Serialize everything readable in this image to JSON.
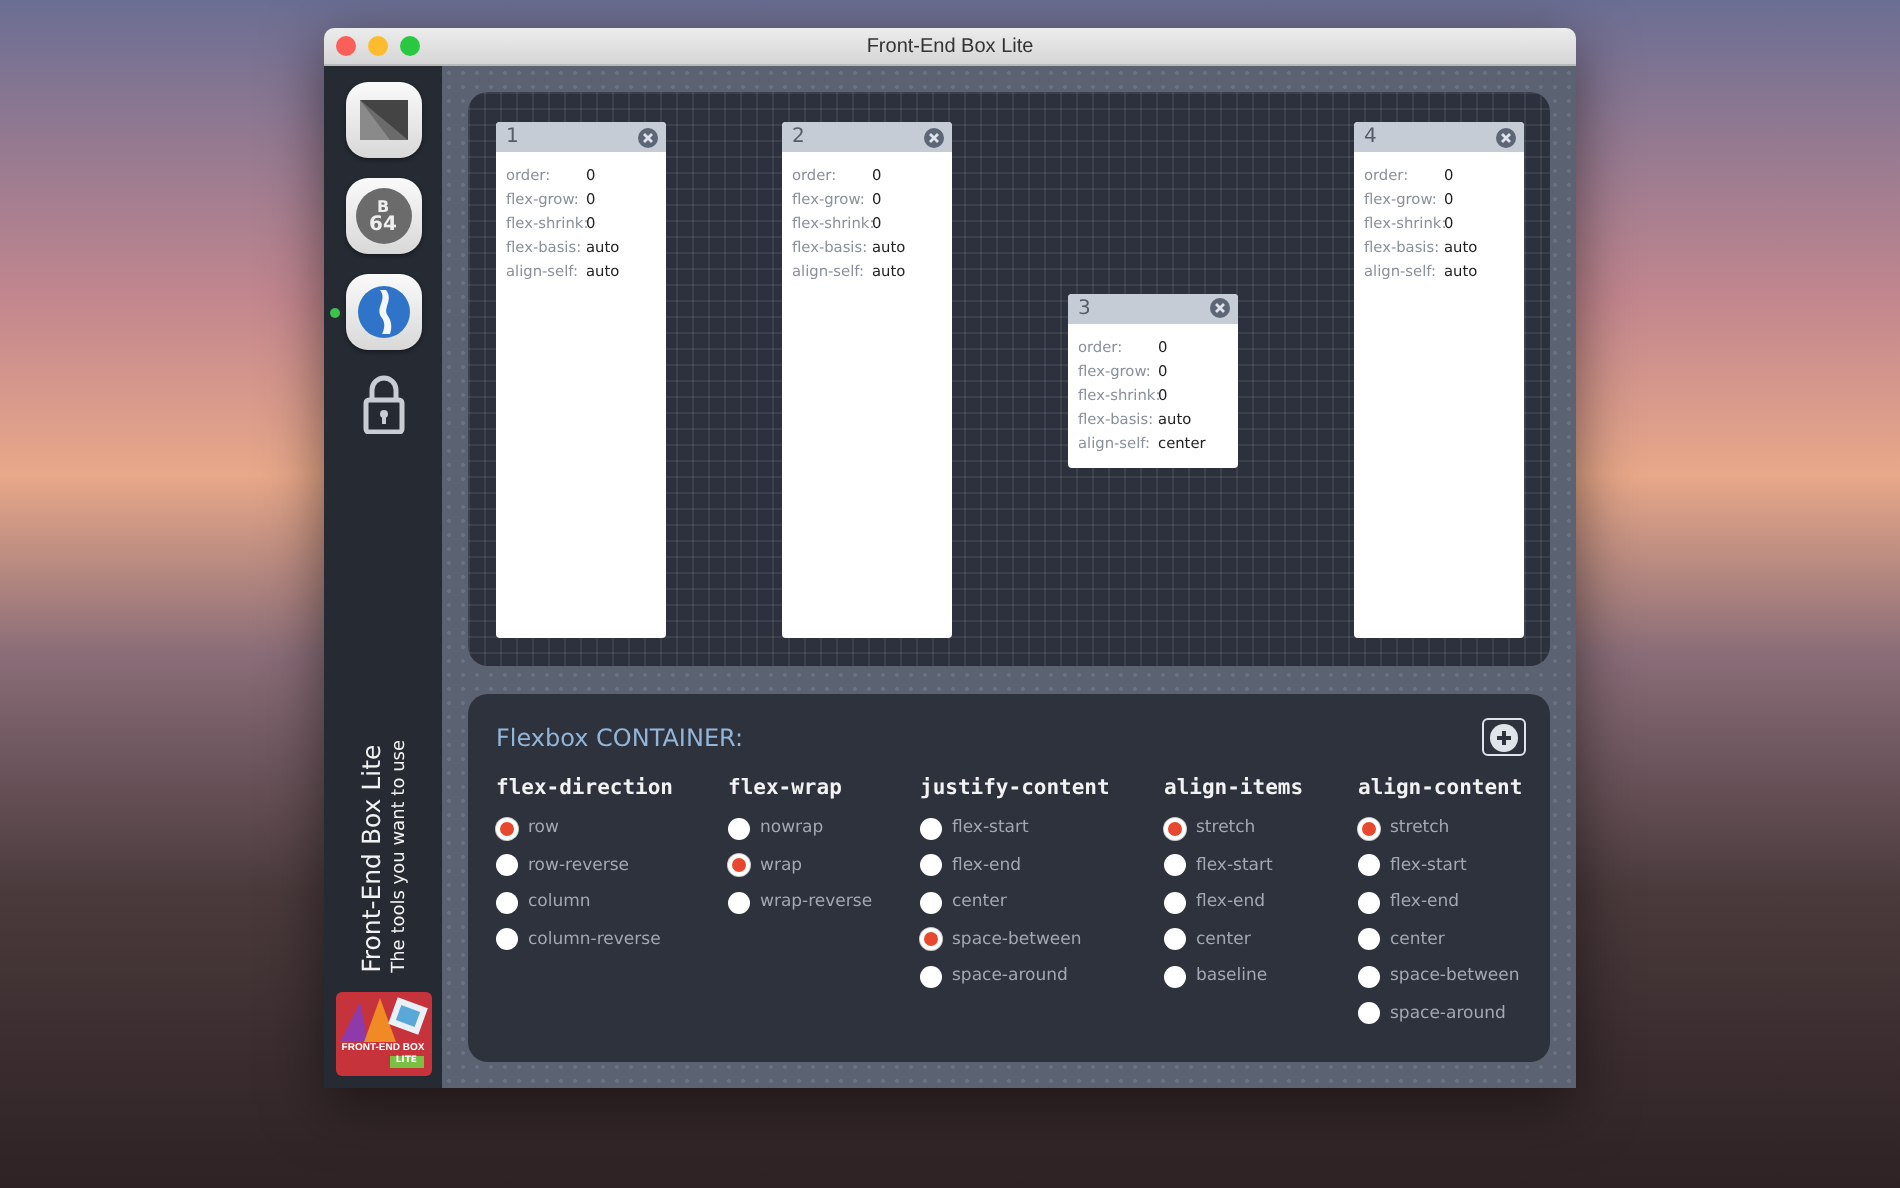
{
  "window": {
    "title": "Front-End Box Lite"
  },
  "sidebar": {
    "tools": [
      {
        "kind": "mail",
        "selected": false
      },
      {
        "kind": "base64",
        "label": "B",
        "label2": "64",
        "selected": false
      },
      {
        "kind": "flexbox",
        "selected": true
      },
      {
        "kind": "lock",
        "selected": false
      }
    ],
    "app_name": "Front-End Box Lite",
    "tagline": "The tools you want to use",
    "logo": {
      "text": "FRONT-END BOX",
      "badge": "LITE"
    }
  },
  "canvas": {
    "items": [
      {
        "number": "1",
        "centered": false,
        "props": [
          [
            "order:",
            "0"
          ],
          [
            "flex-grow:",
            "0"
          ],
          [
            "flex-shrink:",
            "0"
          ],
          [
            "flex-basis:",
            "auto"
          ],
          [
            "align-self:",
            "auto"
          ]
        ]
      },
      {
        "number": "2",
        "centered": false,
        "props": [
          [
            "order:",
            "0"
          ],
          [
            "flex-grow:",
            "0"
          ],
          [
            "flex-shrink:",
            "0"
          ],
          [
            "flex-basis:",
            "auto"
          ],
          [
            "align-self:",
            "auto"
          ]
        ]
      },
      {
        "number": "3",
        "centered": true,
        "props": [
          [
            "order:",
            "0"
          ],
          [
            "flex-grow:",
            "0"
          ],
          [
            "flex-shrink:",
            "0"
          ],
          [
            "flex-basis:",
            "auto"
          ],
          [
            "align-self:",
            "center"
          ]
        ]
      },
      {
        "number": "4",
        "centered": false,
        "props": [
          [
            "order:",
            "0"
          ],
          [
            "flex-grow:",
            "0"
          ],
          [
            "flex-shrink:",
            "0"
          ],
          [
            "flex-basis:",
            "auto"
          ],
          [
            "align-self:",
            "auto"
          ]
        ]
      }
    ]
  },
  "container": {
    "title": "Flexbox CONTAINER:",
    "groups": [
      {
        "name": "flex-direction",
        "options": [
          {
            "label": "row",
            "selected": true
          },
          {
            "label": "row-reverse",
            "selected": false
          },
          {
            "label": "column",
            "selected": false
          },
          {
            "label": "column-reverse",
            "selected": false
          }
        ]
      },
      {
        "name": "flex-wrap",
        "options": [
          {
            "label": "nowrap",
            "selected": false
          },
          {
            "label": "wrap",
            "selected": true
          },
          {
            "label": "wrap-reverse",
            "selected": false
          }
        ]
      },
      {
        "name": "justify-content",
        "options": [
          {
            "label": "flex-start",
            "selected": false
          },
          {
            "label": "flex-end",
            "selected": false
          },
          {
            "label": "center",
            "selected": false
          },
          {
            "label": "space-between",
            "selected": true
          },
          {
            "label": "space-around",
            "selected": false
          }
        ]
      },
      {
        "name": "align-items",
        "options": [
          {
            "label": "stretch",
            "selected": true
          },
          {
            "label": "flex-start",
            "selected": false
          },
          {
            "label": "flex-end",
            "selected": false
          },
          {
            "label": "center",
            "selected": false
          },
          {
            "label": "baseline",
            "selected": false
          }
        ]
      },
      {
        "name": "align-content",
        "options": [
          {
            "label": "stretch",
            "selected": true
          },
          {
            "label": "flex-start",
            "selected": false
          },
          {
            "label": "flex-end",
            "selected": false
          },
          {
            "label": "center",
            "selected": false
          },
          {
            "label": "space-between",
            "selected": false
          },
          {
            "label": "space-around",
            "selected": false
          }
        ]
      }
    ]
  }
}
